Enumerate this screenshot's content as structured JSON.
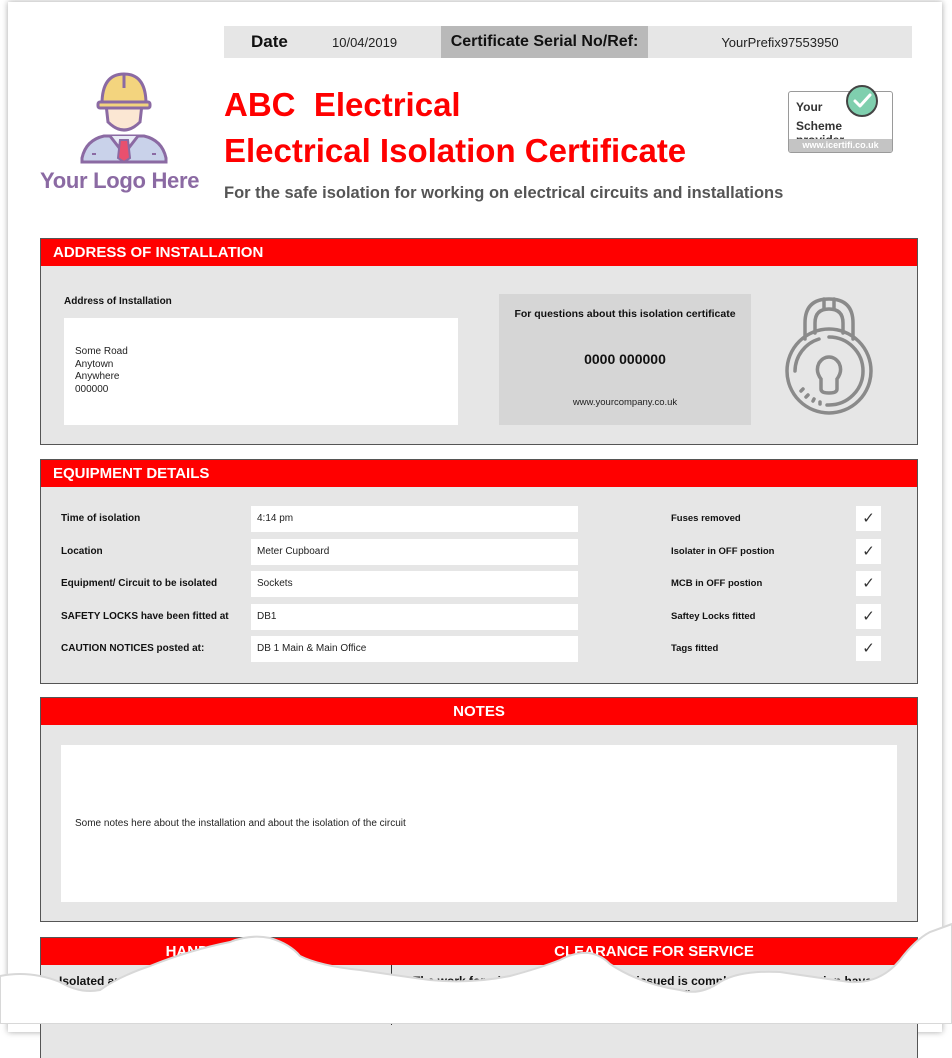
{
  "meta": {
    "date_label": "Date",
    "date_value": "10/04/2019",
    "serial_label": "Certificate Serial No/Ref:",
    "serial_value": "YourPrefix97553950"
  },
  "logo": {
    "text": "Your Logo Here",
    "icon": "construction-worker-icon"
  },
  "title": {
    "line1": "ABC  Electrical",
    "line2": "Electrical Isolation Certificate",
    "subtitle": "For the safe isolation for working on electrical circuits and installations"
  },
  "badge": {
    "line1": "Your",
    "line2": "Scheme provider",
    "url": "www.icertifi.co.uk",
    "icon": "check-circle-icon"
  },
  "address_section": {
    "header": "ADDRESS OF INSTALLATION",
    "label": "Address of Installation",
    "lines": [
      "Some Road",
      "Anytown",
      "Anywhere",
      "000000"
    ],
    "contact": {
      "question": "For questions about this isolation certificate",
      "phone": "0000 000000",
      "website": "www.yourcompany.co.uk"
    },
    "icon": "padlock-icon"
  },
  "equipment_section": {
    "header": "EQUIPMENT DETAILS",
    "fields": [
      {
        "label": "Time of isolation",
        "value": "4:14 pm"
      },
      {
        "label": "Location",
        "value": "Meter Cupboard"
      },
      {
        "label": "Equipment/ Circuit to be isolated",
        "value": "Sockets"
      },
      {
        "label": "SAFETY LOCKS have been fitted at",
        "value": "DB1"
      },
      {
        "label": "CAUTION NOTICES posted at:",
        "value": "DB 1 Main & Main Office"
      }
    ],
    "checks": [
      {
        "label": "Fuses removed",
        "mark": "✓",
        "checked": true
      },
      {
        "label": "Isolater in OFF postion",
        "mark": "✓",
        "checked": true
      },
      {
        "label": "MCB in OFF postion",
        "mark": "✓",
        "checked": true
      },
      {
        "label": "Saftey Locks fitted",
        "mark": "✓",
        "checked": true
      },
      {
        "label": "Tags fitted",
        "mark": "✓",
        "checked": true
      }
    ]
  },
  "notes_section": {
    "header": "NOTES",
    "text": "Some notes here about the installation and about the isolation of the circuit"
  },
  "bottom_section": {
    "handover_header": "HANDOVER D",
    "handover_text": "Isolated and ver",
    "clearance_header": "CLEARANCE FOR SERVICE",
    "clearance_text": "The work for which this certificate was issued is complete.  Locks, Isolation have been removed. Equipment covered by this certificate is e"
  },
  "colors": {
    "accent_red": "#ff0000",
    "panel_grey": "#e6e6e6",
    "logo_purple": "#8b6aa3",
    "badge_green": "#7fcfae"
  }
}
